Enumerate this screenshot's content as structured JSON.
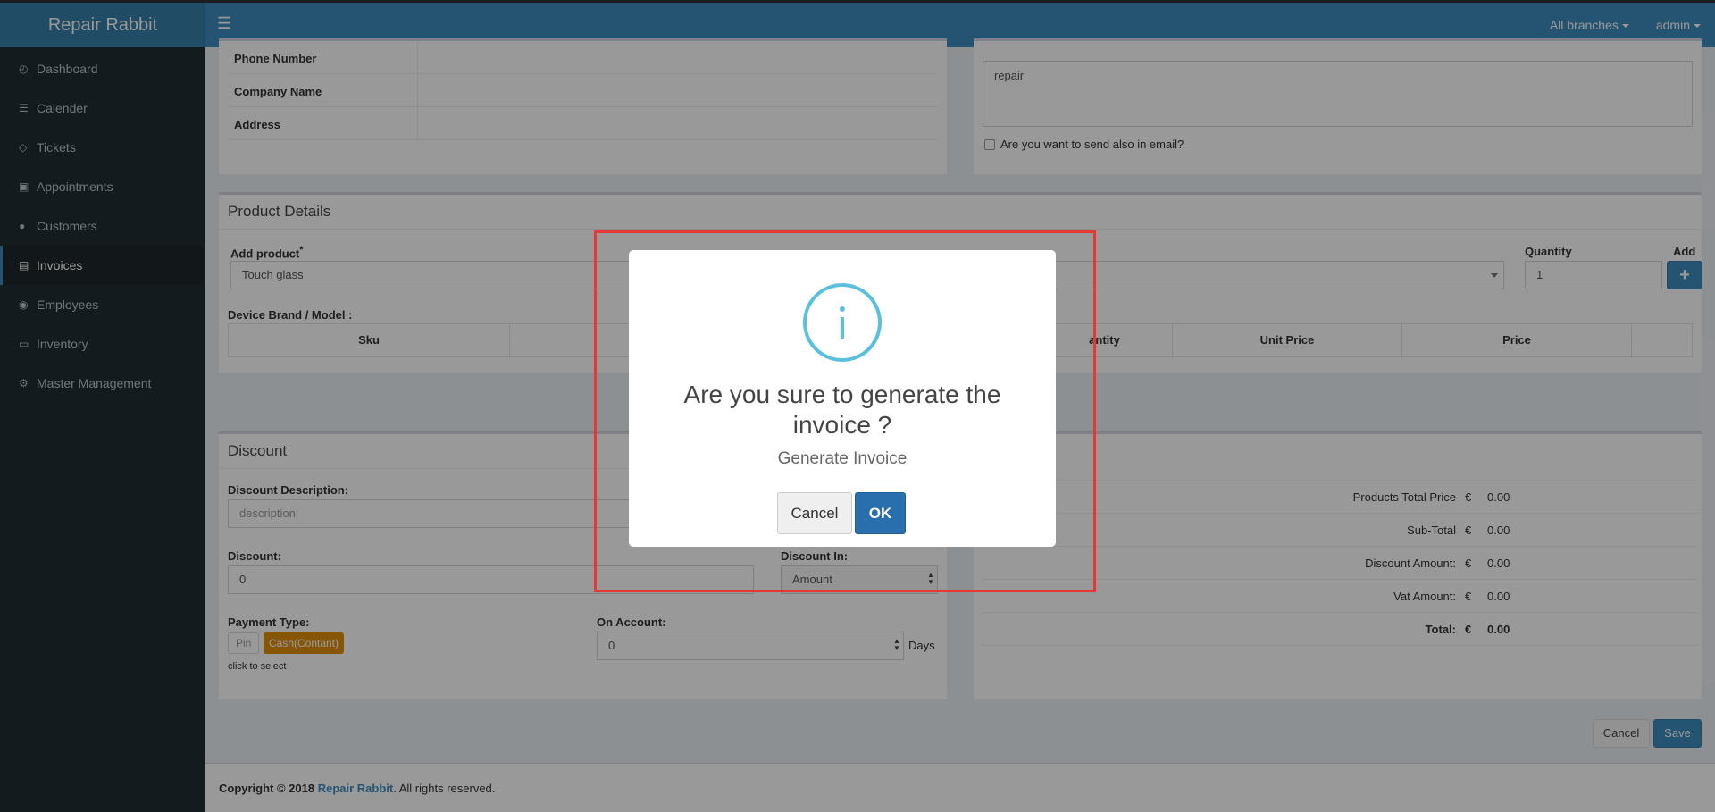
{
  "app": {
    "brand": "Repair Rabbit"
  },
  "topnav": {
    "branches": "All branches",
    "user": "admin"
  },
  "sidebar": {
    "items": [
      {
        "label": "Dashboard",
        "icon": "dashboard-icon"
      },
      {
        "label": "Calender",
        "icon": "list-icon"
      },
      {
        "label": "Tickets",
        "icon": "tag-icon"
      },
      {
        "label": "Appointments",
        "icon": "calendar-plus-icon"
      },
      {
        "label": "Customers",
        "icon": "users-icon"
      },
      {
        "label": "Invoices",
        "icon": "file-icon"
      },
      {
        "label": "Employees",
        "icon": "user-circle-icon"
      },
      {
        "label": "Inventory",
        "icon": "list-alt-icon"
      },
      {
        "label": "Master Management",
        "icon": "cogs-icon"
      }
    ],
    "active": "Invoices"
  },
  "customer": {
    "phone_label": "Phone Number",
    "company_label": "Company Name",
    "address_label": "Address"
  },
  "invoice": {
    "description_value": "repair",
    "email_checkbox_label": "Are you want to send also in email?"
  },
  "product": {
    "title": "Product Details",
    "add_product_label": "Add product",
    "required_mark": "*",
    "add_product_value": "Touch glass",
    "quantity_label": "Quantity",
    "quantity_value": "1",
    "add_label": "Add",
    "device_label": "Device Brand / Model :",
    "columns": [
      "Sku",
      "",
      "antity",
      "Unit Price",
      "Price",
      ""
    ]
  },
  "discount": {
    "title": "Discount",
    "description_label": "Discount Description:",
    "description_placeholder": "description",
    "discount_label": "Discount:",
    "discount_value": "0",
    "discount_in_label": "Discount In:",
    "discount_in_value": "Amount",
    "payment_type_label": "Payment Type:",
    "payment_pin": "Pin",
    "payment_cash": "Cash(Contant)",
    "click_to_select": "click to select",
    "on_account_label": "On Account:",
    "on_account_value": "0",
    "days_label": "Days"
  },
  "summary": {
    "currency": "€",
    "rows": [
      {
        "label": "Products Total Price",
        "value": "0.00"
      },
      {
        "label": "Sub-Total",
        "value": "0.00"
      },
      {
        "label": "Discount Amount:",
        "value": "0.00"
      },
      {
        "label": "Vat Amount:",
        "value": "0.00"
      },
      {
        "label": "Total:",
        "value": "0.00"
      }
    ]
  },
  "actions": {
    "cancel": "Cancel",
    "save": "Save"
  },
  "footer": {
    "prefix": "Copyright © 2018 ",
    "link": "Repair Rabbit",
    "suffix": ". All rights reserved."
  },
  "modal": {
    "title": "Are you sure to generate the invoice ?",
    "text": "Generate Invoice",
    "cancel": "Cancel",
    "ok": "OK",
    "icon": "info-icon"
  },
  "colors": {
    "header": "#3c8dbc",
    "sidebar": "#222d32",
    "highlight": "#e53935",
    "info": "#5bc0de",
    "cash_badge": "#e08e0b"
  }
}
